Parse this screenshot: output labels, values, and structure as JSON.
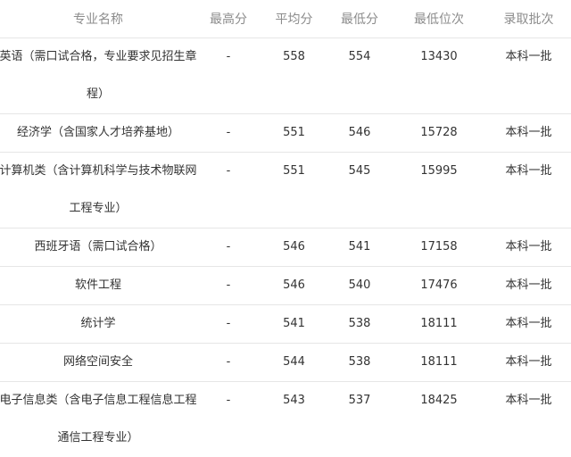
{
  "table": {
    "headers": [
      "专业名称",
      "最高分",
      "平均分",
      "最低分",
      "最低位次",
      "录取批次"
    ],
    "rows": [
      {
        "name": "英语（需口试合格，专业要求见招生章程）",
        "max": "-",
        "avg": "558",
        "min": "554",
        "rank": "13430",
        "batch": "本科一批"
      },
      {
        "name": "经济学（含国家人才培养基地）",
        "max": "-",
        "avg": "551",
        "min": "546",
        "rank": "15728",
        "batch": "本科一批"
      },
      {
        "name": "计算机类（含计算机科学与技术物联网工程专业）",
        "max": "-",
        "avg": "551",
        "min": "545",
        "rank": "15995",
        "batch": "本科一批"
      },
      {
        "name": "西班牙语（需口试合格）",
        "max": "-",
        "avg": "546",
        "min": "541",
        "rank": "17158",
        "batch": "本科一批"
      },
      {
        "name": "软件工程",
        "max": "-",
        "avg": "546",
        "min": "540",
        "rank": "17476",
        "batch": "本科一批"
      },
      {
        "name": "统计学",
        "max": "-",
        "avg": "541",
        "min": "538",
        "rank": "18111",
        "batch": "本科一批"
      },
      {
        "name": "网络空间安全",
        "max": "-",
        "avg": "544",
        "min": "538",
        "rank": "18111",
        "batch": "本科一批"
      },
      {
        "name": "电子信息类（含电子信息工程信息工程通信工程专业）",
        "max": "-",
        "avg": "543",
        "min": "537",
        "rank": "18425",
        "batch": "本科一批"
      }
    ]
  }
}
